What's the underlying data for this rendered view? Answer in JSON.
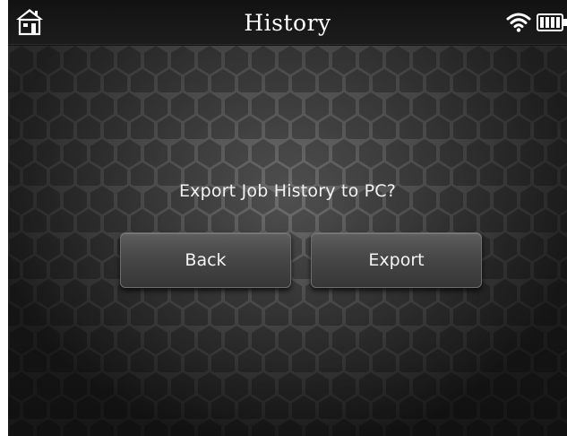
{
  "header": {
    "title": "History",
    "icons": [
      "home-icon",
      "wifi-icon",
      "battery-icon"
    ]
  },
  "dialog": {
    "prompt": "Export Job History to PC?",
    "back_label": "Back",
    "export_label": "Export"
  },
  "colors": {
    "background": "#141414",
    "button": "#474747",
    "text": "#ffffff"
  }
}
